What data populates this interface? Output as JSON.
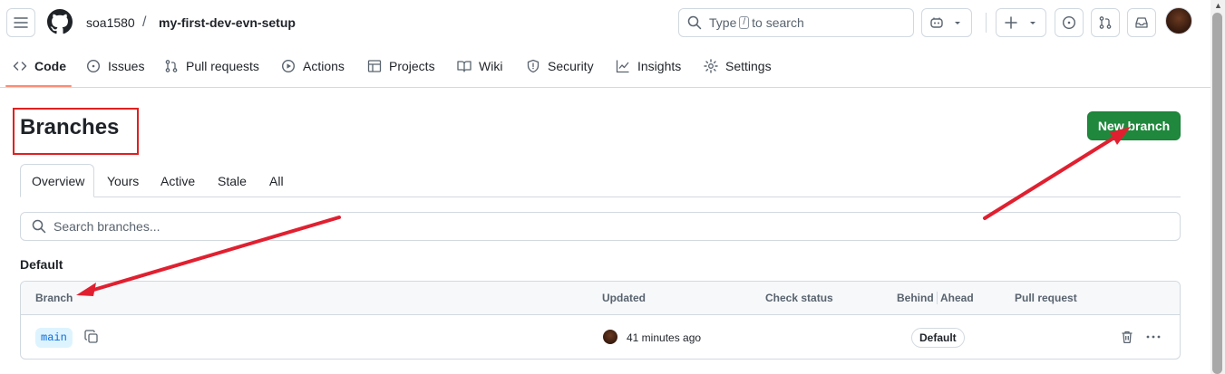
{
  "header": {
    "owner": "soa1580",
    "separator": "/",
    "repo": "my-first-dev-evn-setup",
    "search": {
      "prefix": "Type",
      "kbd": "/",
      "suffix": "to search"
    },
    "icons": [
      "hamburger-icon",
      "github-logo-icon",
      "copilot-icon",
      "plus-icon",
      "issue-icon",
      "pull-request-icon",
      "inbox-icon"
    ]
  },
  "tabs": [
    {
      "label": "Code",
      "icon": "code-icon",
      "active": true
    },
    {
      "label": "Issues",
      "icon": "issue-icon"
    },
    {
      "label": "Pull requests",
      "icon": "pull-request-icon"
    },
    {
      "label": "Actions",
      "icon": "play-icon"
    },
    {
      "label": "Projects",
      "icon": "table-icon"
    },
    {
      "label": "Wiki",
      "icon": "book-icon"
    },
    {
      "label": "Security",
      "icon": "shield-icon"
    },
    {
      "label": "Insights",
      "icon": "graph-icon"
    },
    {
      "label": "Settings",
      "icon": "gear-icon"
    }
  ],
  "page": {
    "title": "Branches",
    "new_branch_label": "New branch",
    "subtabs": [
      "Overview",
      "Yours",
      "Active",
      "Stale",
      "All"
    ],
    "search_placeholder": "Search branches...",
    "section_label": "Default"
  },
  "table": {
    "headers": {
      "branch": "Branch",
      "updated": "Updated",
      "check_status": "Check status",
      "behind": "Behind",
      "ahead": "Ahead",
      "pull_request": "Pull request"
    },
    "rows": [
      {
        "branch": "main",
        "updated": "41 minutes ago",
        "badge": "Default"
      }
    ]
  },
  "colors": {
    "primary_green": "#1f883d",
    "active_tab_underline": "#fd8c73",
    "annotation_red": "#e02020",
    "branch_pill_bg": "#ddf4ff",
    "link_blue": "#0969da"
  }
}
